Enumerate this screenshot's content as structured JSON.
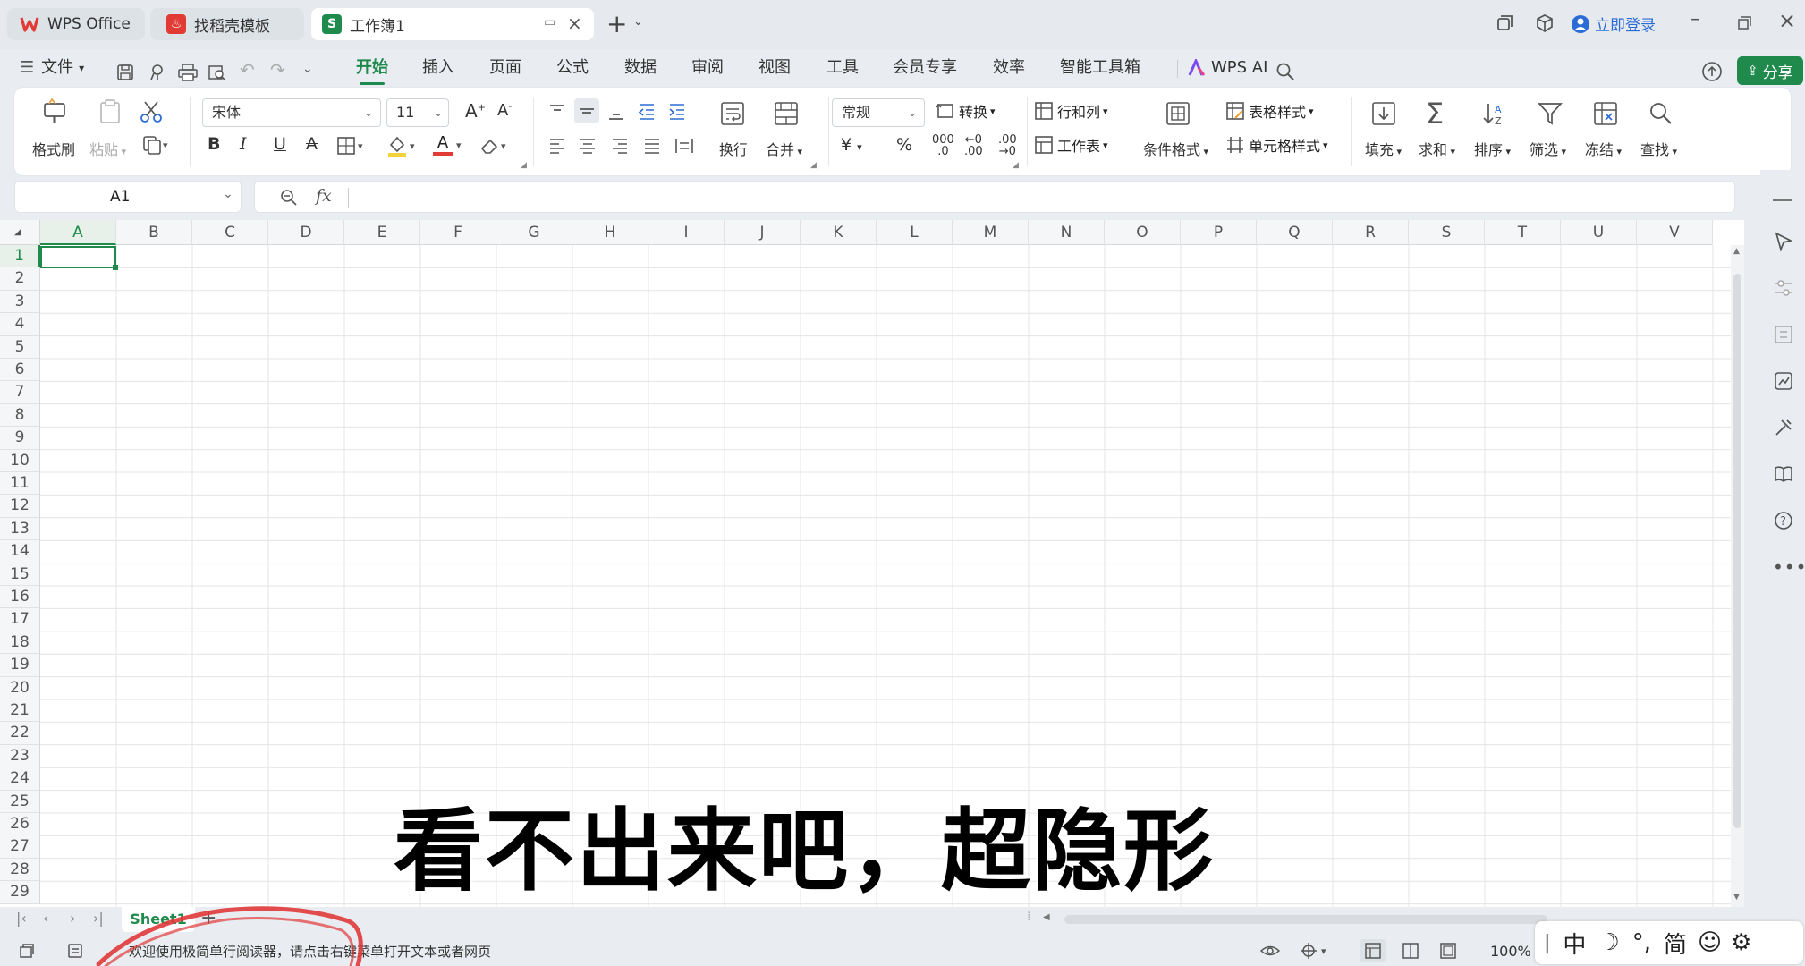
{
  "titlebar": {
    "tabs": [
      {
        "label": "WPS Office"
      },
      {
        "label": "找稻壳模板"
      },
      {
        "label": "工作簿1"
      }
    ],
    "login": "立即登录"
  },
  "menubar": {
    "file": "文件",
    "items": [
      "开始",
      "插入",
      "页面",
      "公式",
      "数据",
      "审阅",
      "视图",
      "工具",
      "会员专享",
      "效率",
      "智能工具箱"
    ],
    "ai": "WPS AI",
    "share": "分享"
  },
  "ribbon": {
    "format_painter": "格式刷",
    "paste": "粘贴",
    "font_name": "宋体",
    "font_size": "11",
    "number_format": "常规",
    "convert": "转换",
    "wrap": "换行",
    "merge": "合并",
    "rows_cols": "行和列",
    "worksheet": "工作表",
    "cond_format": "条件格式",
    "table_style": "表格样式",
    "cell_style": "单元格样式",
    "fill": "填充",
    "sum": "求和",
    "sort": "排序",
    "filter": "筛选",
    "freeze": "冻结",
    "find": "查找",
    "bold": "B",
    "italic": "I",
    "underline": "U",
    "strike": "A",
    "font_color": "A",
    "currency": "¥",
    "percent": "%"
  },
  "formula_bar": {
    "cell_ref": "A1",
    "fx": "fx",
    "value": ""
  },
  "grid": {
    "columns": [
      "A",
      "B",
      "C",
      "D",
      "E",
      "F",
      "G",
      "H",
      "I",
      "J",
      "K",
      "L",
      "M",
      "N",
      "O",
      "P",
      "Q",
      "R",
      "S",
      "T",
      "U",
      "V"
    ],
    "rows": [
      "1",
      "2",
      "3",
      "4",
      "5",
      "6",
      "7",
      "8",
      "9",
      "10",
      "11",
      "12",
      "13",
      "14",
      "15",
      "16",
      "17",
      "18",
      "19",
      "20",
      "21",
      "22",
      "23",
      "24",
      "25",
      "26",
      "27",
      "28",
      "29"
    ],
    "selected": "A1"
  },
  "sheets": {
    "active": "Sheet1",
    "add": "+"
  },
  "status": {
    "message": "欢迎使用极简单行阅读器，请点击右键菜单打开文本或者网页",
    "zoom": "100%",
    "ime": [
      "中",
      "简"
    ]
  },
  "subtitle": "看不出来吧，超隐形",
  "colors": {
    "accent": "#1f8a4c",
    "wps_red": "#e23b35",
    "selection": "#1f8a4c",
    "blue": "#2b6bd6"
  }
}
